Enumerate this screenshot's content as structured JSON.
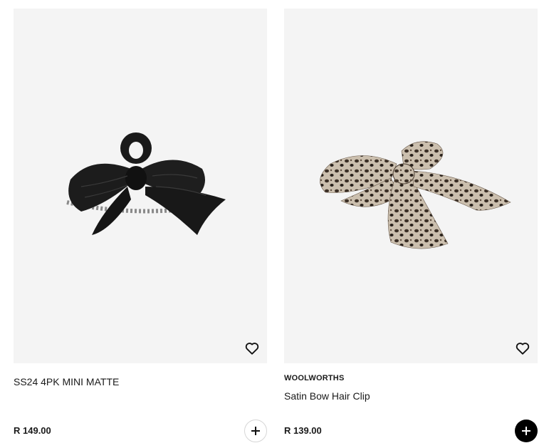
{
  "products": [
    {
      "brand": "",
      "name": "SS24 4PK MINI MATTE",
      "price": "R 149.00",
      "image_icon": "black-bow-claw-clip-image",
      "add_button_style": "outline"
    },
    {
      "brand": "WOOLWORTHS",
      "name": "Satin Bow Hair Clip",
      "price": "R 139.00",
      "image_icon": "leopard-print-bow-clip-image",
      "add_button_style": "filled"
    }
  ],
  "colors": {
    "image_background": "#f4f4f4",
    "text": "#1a1a1a",
    "add_filled": "#000000"
  }
}
